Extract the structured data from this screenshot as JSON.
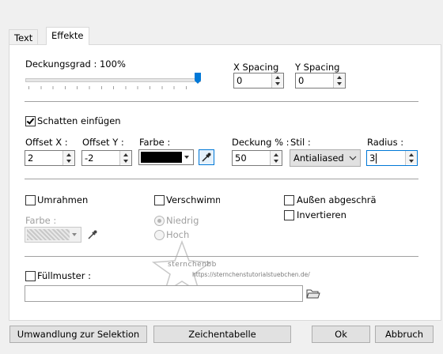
{
  "tabs": [
    {
      "label": "Text"
    },
    {
      "label": "Effekte"
    }
  ],
  "opacity": {
    "label": "Deckungsgrad : 100%",
    "value_percent": 100
  },
  "x_spacing": {
    "label": "X Spacing",
    "value": "0"
  },
  "y_spacing": {
    "label": "Y Spacing",
    "value": "0"
  },
  "shadow": {
    "checkbox_label": "Schatten einfügen",
    "checked": true,
    "offset_x": {
      "label": "Offset X :",
      "value": "2"
    },
    "offset_y": {
      "label": "Offset Y :",
      "value": "-2"
    },
    "color": {
      "label": "Farbe :",
      "swatch": "#000000"
    },
    "opacity": {
      "label": "Deckung % :",
      "value": "50"
    },
    "style": {
      "label": "Stil :",
      "value": "Antialiased"
    },
    "radius": {
      "label": "Radius :",
      "value": "3"
    }
  },
  "border": {
    "checkbox_label": "Umrahmen",
    "color_label": "Farbe :"
  },
  "blur": {
    "checkbox_label": "Verschwimm",
    "options": [
      {
        "label": "Niedrig",
        "checked": true
      },
      {
        "label": "Hoch",
        "checked": false
      }
    ]
  },
  "bevel_outer": {
    "checkbox_label": "Außen abgeschräg"
  },
  "invert": {
    "checkbox_label": "Invertieren"
  },
  "fill_pattern": {
    "checkbox_label": "Füllmuster :",
    "path": ""
  },
  "watermark": {
    "line1": "sternchenbb",
    "line2": "https://sternchenstutorialstuebchen.de/"
  },
  "footer": {
    "convert_label": "Umwandlung zur Selektion",
    "charmap_label": "Zeichentabelle",
    "ok_label": "Ok",
    "cancel_label": "Abbruch"
  }
}
